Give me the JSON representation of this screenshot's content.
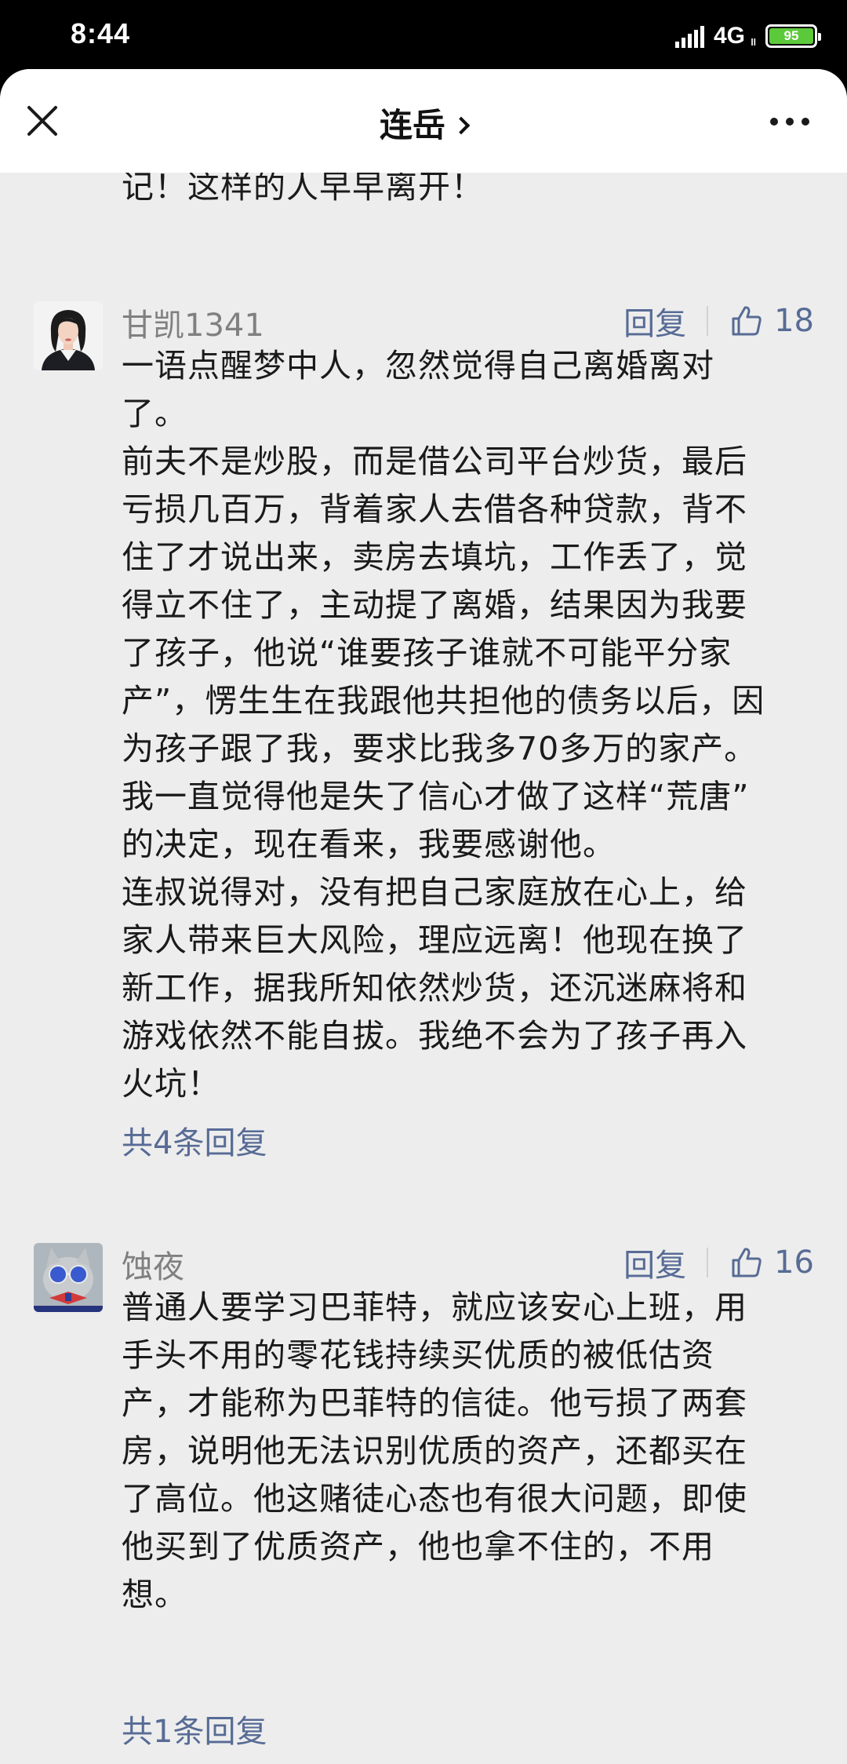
{
  "status_bar": {
    "time": "8:44",
    "network": "4G",
    "network_sub": "ll",
    "battery": "95"
  },
  "header": {
    "title": "连岳"
  },
  "previous_comment": {
    "text_lines": [
      "记！这样的人早早离开！"
    ]
  },
  "comments": [
    {
      "author": "甘凯1341",
      "reply_label": "回复",
      "likes": "18",
      "text_lines": [
        "一语点醒梦中人，忽然觉得自己离婚离对",
        "了。",
        "前夫不是炒股，而是借公司平台炒货，最后",
        "亏损几百万，背着家人去借各种贷款，背不",
        "住了才说出来，卖房去填坑，工作丢了，觉",
        "得立不住了，主动提了离婚，结果因为我要",
        "了孩子，他说“谁要孩子谁就不可能平分家",
        "产”，愣生生在我跟他共担他的债务以后，因",
        "为孩子跟了我，要求比我多70多万的家产。",
        "我一直觉得他是失了信心才做了这样“荒唐”",
        "的决定，现在看来，我要感谢他。",
        "连叔说得对，没有把自己家庭放在心上，给",
        "家人带来巨大风险，理应远离！他现在换了",
        "新工作，据我所知依然炒货，还沉迷麻将和",
        "游戏依然不能自拔。我绝不会为了孩子再入",
        "火坑！"
      ],
      "replies_label": "共4条回复"
    },
    {
      "author": "蚀夜",
      "reply_label": "回复",
      "likes": "16",
      "text_lines": [
        "普通人要学习巴菲特，就应该安心上班，用",
        "手头不用的零花钱持续买优质的被低估资",
        "产，才能称为巴菲特的信徒。他亏损了两套",
        "房，说明他无法识别优质的资产，还都买在",
        "了高位。他这赌徒心态也有很大问题，即使",
        "他买到了优质资产，他也拿不住的，不用",
        "想。"
      ],
      "replies_label": "共1条回复"
    }
  ],
  "colors": {
    "link": "#576b95",
    "background": "#ededed",
    "text": "#1a1a1a",
    "meta": "#808080"
  }
}
